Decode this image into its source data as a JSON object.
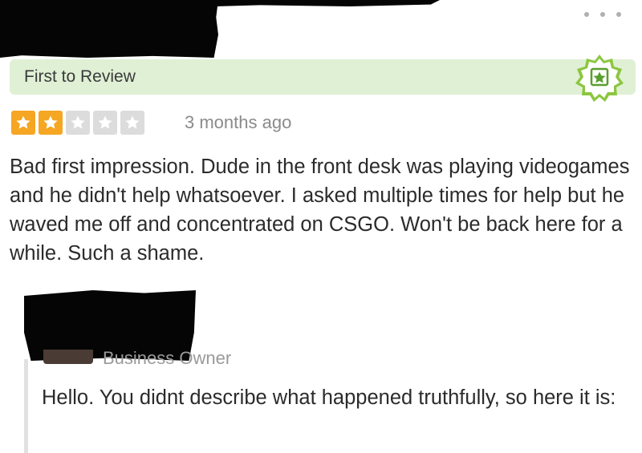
{
  "header": {
    "more_icon": "more-dots-icon"
  },
  "banner": {
    "label": "First to Review",
    "badge_icon": "first-to-review-badge-icon",
    "background_color": "#dff0d5"
  },
  "review": {
    "rating": 2,
    "rating_max": 5,
    "star_color": "#f5a623",
    "time": "3 months ago",
    "text": "Bad first impression. Dude in the front desk was playing videogames and he didn't help whatsoever. I asked multiple times for help but he waved me off and concentrated on CSGO. Won't be back here for a while. Such a shame."
  },
  "reply": {
    "owner_label": "Business Owner",
    "text": "Hello. You didnt describe what happened truthfully, so here it is:"
  }
}
